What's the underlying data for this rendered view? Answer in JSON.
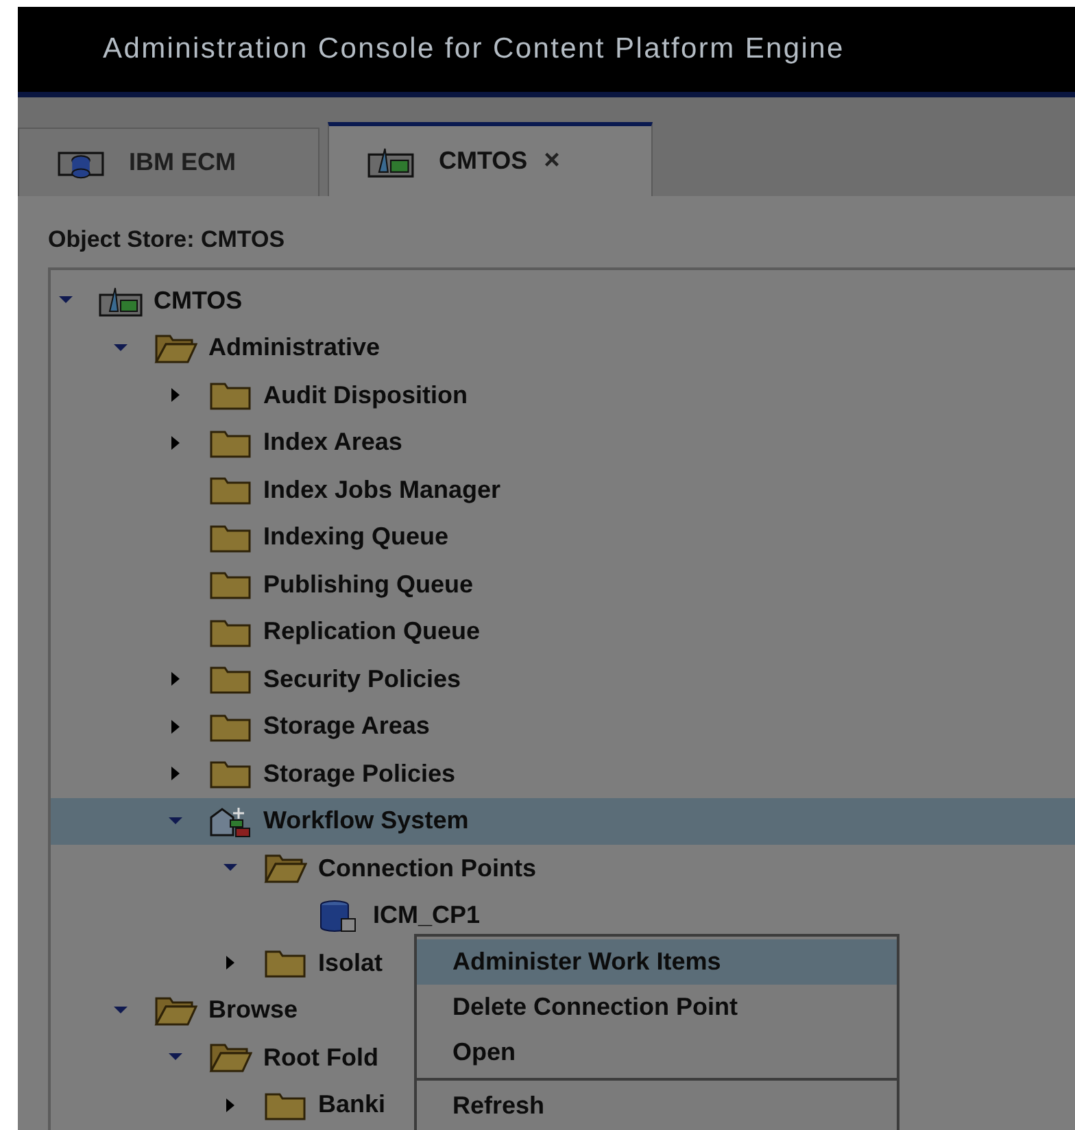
{
  "window": {
    "title": "Administration Console for Content Platform Engine"
  },
  "tabs": [
    {
      "label": "IBM ECM",
      "kind": "domain",
      "selected": false
    },
    {
      "label": "CMTOS",
      "kind": "store",
      "selected": true,
      "close_label": "×"
    }
  ],
  "object_store_label": "Object Store: CMTOS",
  "tree": [
    {
      "label": "CMTOS",
      "kind": "store",
      "expanded": true,
      "selected": false,
      "children": [
        {
          "label": "Administrative",
          "kind": "folder",
          "expanded": true,
          "selected": false,
          "children": [
            {
              "label": "Audit Disposition",
              "kind": "folder",
              "expanded": false,
              "selected": false
            },
            {
              "label": "Index Areas",
              "kind": "folder",
              "expanded": false,
              "selected": false
            },
            {
              "label": "Index Jobs Manager",
              "kind": "folder",
              "selected": false
            },
            {
              "label": "Indexing Queue",
              "kind": "folder",
              "selected": false
            },
            {
              "label": "Publishing Queue",
              "kind": "folder",
              "selected": false
            },
            {
              "label": "Replication Queue",
              "kind": "folder",
              "selected": false
            },
            {
              "label": "Security Policies",
              "kind": "folder",
              "expanded": false,
              "selected": false
            },
            {
              "label": "Storage Areas",
              "kind": "folder",
              "expanded": false,
              "selected": false
            },
            {
              "label": "Storage Policies",
              "kind": "folder",
              "expanded": false,
              "selected": false
            },
            {
              "label": "Workflow System",
              "kind": "workflow",
              "expanded": true,
              "selected": true,
              "children": [
                {
                  "label": "Connection Points",
                  "kind": "folder",
                  "expanded": true,
                  "selected": false,
                  "children": [
                    {
                      "label": "ICM_CP1",
                      "kind": "connection",
                      "selected": false
                    }
                  ]
                },
                {
                  "label": "Isolat",
                  "kind": "folder",
                  "expanded": false,
                  "selected": false
                }
              ]
            }
          ]
        },
        {
          "label": "Browse",
          "kind": "folder",
          "expanded": true,
          "selected": false,
          "children": [
            {
              "label": "Root Fold",
              "kind": "folder",
              "expanded": true,
              "selected": false,
              "children": [
                {
                  "label": "Banki",
                  "kind": "folder",
                  "expanded": false,
                  "selected": false
                }
              ]
            }
          ]
        }
      ]
    }
  ],
  "context_menu": [
    {
      "label": "Administer Work Items",
      "selected": true
    },
    {
      "label": "Delete Connection Point",
      "selected": false
    },
    {
      "label": "Open",
      "selected": false,
      "separator_after": true
    },
    {
      "label": "Refresh",
      "selected": false
    }
  ]
}
